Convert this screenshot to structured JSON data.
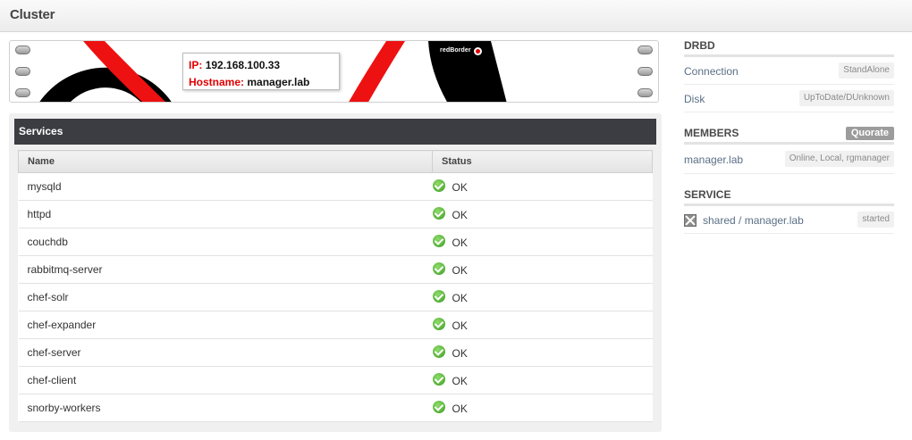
{
  "header": {
    "title": "Cluster"
  },
  "device": {
    "ip_label": "IP:",
    "ip_value": "192.168.100.33",
    "hostname_label": "Hostname:",
    "hostname_value": "manager.lab",
    "brand": "redBorder"
  },
  "services": {
    "title": "Services",
    "columns": [
      "Name",
      "Status"
    ],
    "rows": [
      {
        "name": "mysqld",
        "status": "OK"
      },
      {
        "name": "httpd",
        "status": "OK"
      },
      {
        "name": "couchdb",
        "status": "OK"
      },
      {
        "name": "rabbitmq-server",
        "status": "OK"
      },
      {
        "name": "chef-solr",
        "status": "OK"
      },
      {
        "name": "chef-expander",
        "status": "OK"
      },
      {
        "name": "chef-server",
        "status": "OK"
      },
      {
        "name": "chef-client",
        "status": "OK"
      },
      {
        "name": "snorby-workers",
        "status": "OK"
      }
    ]
  },
  "drbd": {
    "title": "DRBD",
    "items": [
      {
        "label": "Connection",
        "value": "StandAlone"
      },
      {
        "label": "Disk",
        "value": "UpToDate/DUnknown"
      }
    ]
  },
  "members": {
    "title": "MEMBERS",
    "badge": "Quorate",
    "items": [
      {
        "label": "manager.lab",
        "value": "Online, Local, rgmanager"
      }
    ]
  },
  "service": {
    "title": "SERVICE",
    "items": [
      {
        "label": "shared / manager.lab",
        "value": "started"
      }
    ]
  },
  "colors": {
    "accent_red": "#e00000",
    "header_dark": "#3b3d42",
    "ok_green": "#3b9b22"
  }
}
